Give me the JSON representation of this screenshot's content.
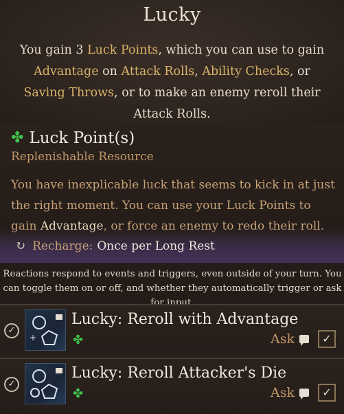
{
  "title": "Lucky",
  "summary": {
    "parts": [
      {
        "text": "You gain 3 ",
        "hl": false
      },
      {
        "text": "Luck Points",
        "hl": true
      },
      {
        "text": ", which you can use to gain ",
        "hl": false
      },
      {
        "text": "Advantage",
        "hl": true
      },
      {
        "text": " on ",
        "hl": false
      },
      {
        "text": "Attack Rolls",
        "hl": true
      },
      {
        "text": ", ",
        "hl": false
      },
      {
        "text": "Ability Checks",
        "hl": true
      },
      {
        "text": ", or ",
        "hl": false
      },
      {
        "text": "Saving Throws",
        "hl": true
      },
      {
        "text": ", or to make an enemy reroll their Attack Rolls.",
        "hl": false
      }
    ]
  },
  "resource": {
    "icon": "clover-icon",
    "title": "Luck Point(s)",
    "subtitle": "Replenishable Resource",
    "desc_before": "You have inexplicable luck that seems to kick in at just the right moment. You can use your Luck Points to gain ",
    "desc_hl": "Advantage",
    "desc_after": ", or force an enemy to redo their roll.",
    "recharge_label": "Recharge:",
    "recharge_value": "Once per Long Rest"
  },
  "info": "Reactions respond to events and triggers, even outside of your turn. You can toggle them on or off, and whether they automatically trigger or ask for input.",
  "reactions": [
    {
      "title": "Lucky: Reroll with Advantage",
      "mode": "Ask",
      "enabled": true,
      "check": "✓"
    },
    {
      "title": "Lucky: Reroll Attacker's Die",
      "mode": "Ask",
      "enabled": true,
      "check": "✓"
    }
  ],
  "colors": {
    "highlight": "#d8b26a",
    "clover": "#3fc04a",
    "recharge_band": "#45305a"
  }
}
